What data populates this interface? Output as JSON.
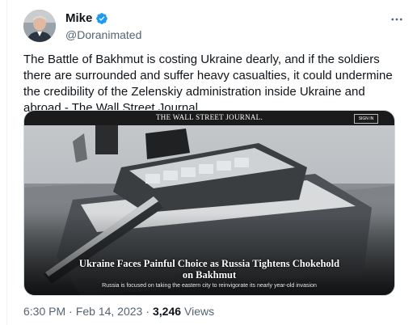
{
  "author": {
    "display_name": "Mike",
    "handle": "@Doranimated",
    "verified": true,
    "verified_color": "#1d9bf0"
  },
  "more_icon": "ellipsis-icon",
  "tweet": {
    "text": "The Battle of Bakhmut is costing Ukraine dearly, and if the soldiers there are surrounded and suffer heavy casualties, it could undermine the credibility of the Zelenskiy administration inside Ukraine and abroad - The Wall Street Journal."
  },
  "media": {
    "publication": "THE WALL STREET JOURNAL.",
    "signin_label": "SIGN IN",
    "headline_line1": "Ukraine Faces Painful Choice as Russia Tightens Chokehold",
    "headline_line2": "on Bakhmut",
    "subhead": "Russia is focused on taking the eastern city to reinvigorate its nearly year-old invasion"
  },
  "meta": {
    "time": "6:30 PM",
    "separator": "·",
    "date": "Feb 14, 2023",
    "views_count": "3,246",
    "views_label": "Views"
  }
}
